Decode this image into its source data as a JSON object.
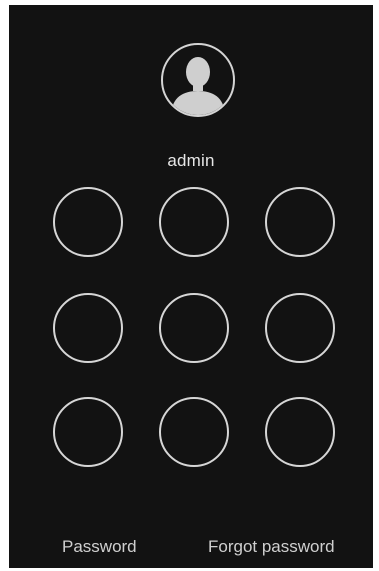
{
  "user": {
    "name": "admin",
    "avatar_icon": "user-silhouette-icon"
  },
  "pattern": {
    "rows": 3,
    "cols": 3
  },
  "footer": {
    "password_label": "Password",
    "forgot_label": "Forgot password"
  },
  "colors": {
    "background": "#121212",
    "stroke": "#d6d6d6",
    "text": "#e6e6e6"
  }
}
